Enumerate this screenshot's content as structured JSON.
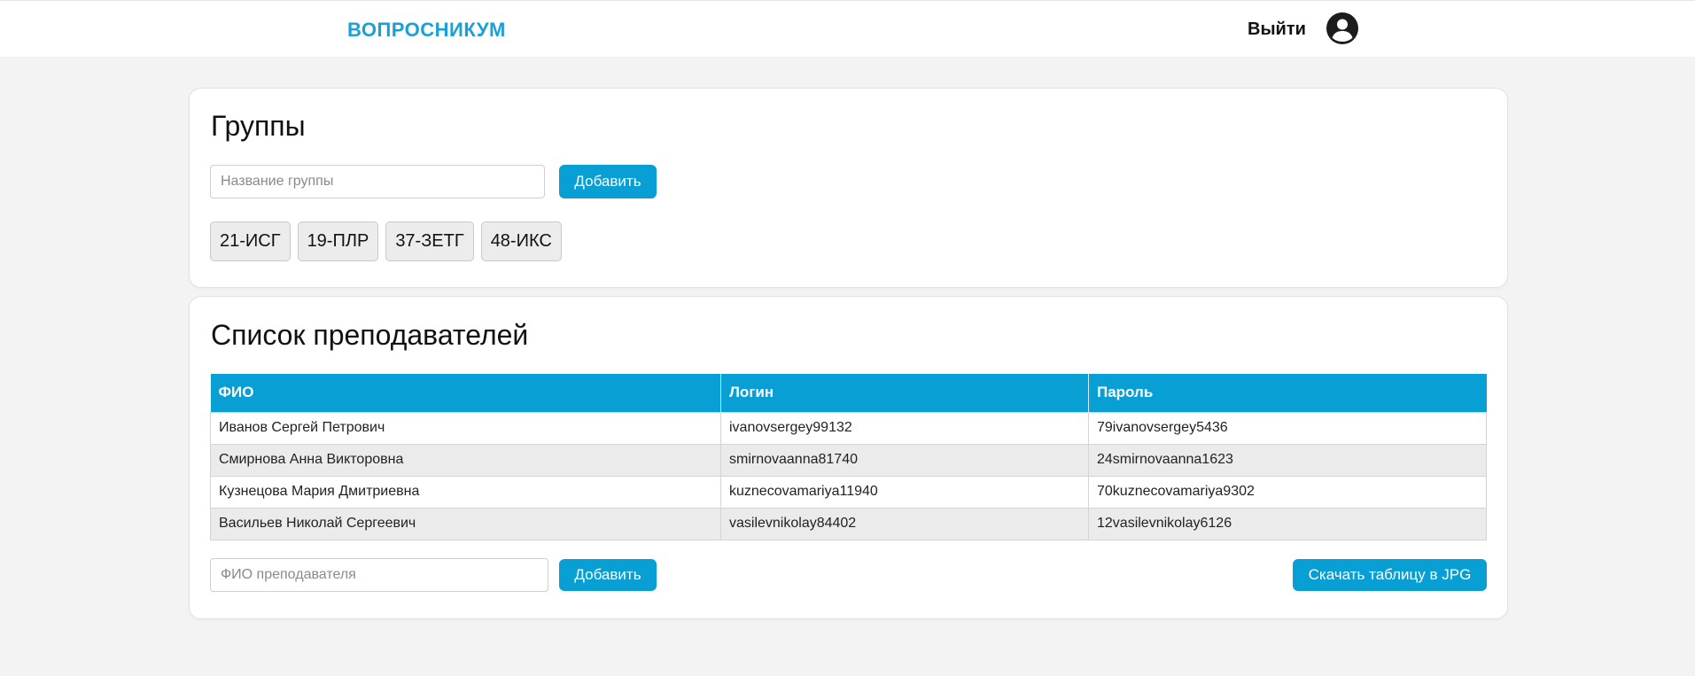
{
  "header": {
    "brand": "ВОПРОСНИКУМ",
    "logout_label": "Выйти"
  },
  "groups": {
    "title": "Группы",
    "input_placeholder": "Название группы",
    "add_label": "Добавить",
    "items": [
      "21-ИСГ",
      "19-ПЛР",
      "37-ЗЕТГ",
      "48-ИКС"
    ]
  },
  "teachers": {
    "title": "Список преподавателей",
    "columns": [
      "ФИО",
      "Логин",
      "Пароль"
    ],
    "rows": [
      [
        "Иванов Сергей Петрович",
        "ivanovsergey99132",
        "79ivanovsergey5436"
      ],
      [
        "Смирнова Анна Викторовна",
        "smirnovaanna81740",
        "24smirnovaanna1623"
      ],
      [
        "Кузнецова Мария Дмитриевна",
        "kuznecovamariya11940",
        "70kuznecovamariya9302"
      ],
      [
        "Васильев Николай Сергеевич",
        "vasilevnikolay84402",
        "12vasilevnikolay6126"
      ]
    ],
    "input_placeholder": "ФИО преподавателя",
    "add_label": "Добавить",
    "download_label": "Скачать таблицу в JPG"
  },
  "colors": {
    "accent": "#089fd4",
    "brand": "#1a9fd6",
    "background": "#f3f3f3"
  },
  "icons": {
    "avatar": "user-circle-icon"
  }
}
